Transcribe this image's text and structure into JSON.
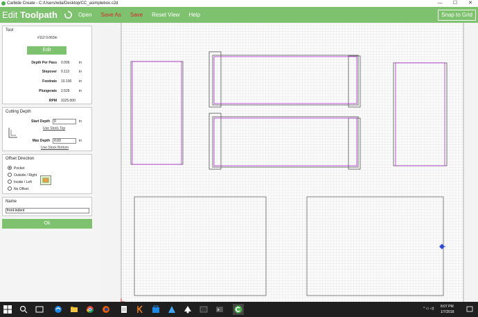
{
  "window": {
    "title": "Carbide Create - C:/Users/wila/Desktop/CC_asimplebox.c2d",
    "minimize": "—",
    "maximize": "☐",
    "close": "✕"
  },
  "toolbar": {
    "mode_prefix": "Edit",
    "mode_name": "Toolpath",
    "open": "Open",
    "save_as": "Save As",
    "save": "Save",
    "reset_view": "Reset View",
    "help": "Help",
    "snap_to_grid": "Snap to Grid"
  },
  "tool": {
    "section_title": "Tool",
    "tool_name": "#112 0.063in",
    "edit_label": "Edit",
    "fields": [
      {
        "label": "Depth Per Pass",
        "value": "0.006",
        "unit": "in"
      },
      {
        "label": "Stepover",
        "value": "0.113",
        "unit": "in"
      },
      {
        "label": "Feedrate",
        "value": "10.100",
        "unit": "in"
      },
      {
        "label": "Plungerate",
        "value": "2.525",
        "unit": "in"
      },
      {
        "label": "RPM",
        "value": "3125.000",
        "unit": ""
      }
    ]
  },
  "cutting_depth": {
    "section_title": "Cutting Depth",
    "start_label": "Start Depth",
    "start_value": "0",
    "start_unit": "in",
    "use_stock_top": "Use Stock Top",
    "max_label": "Max Depth",
    "max_value": "0.03",
    "max_unit": "in",
    "use_stock_bottom": "Use Stock Bottom"
  },
  "offset": {
    "section_title": "Offset Direction",
    "options": [
      "Pocket",
      "Outside / Right",
      "Inside / Left",
      "No Offset"
    ],
    "selected": "Pocket"
  },
  "name": {
    "section_title": "Name",
    "value": "front-indent"
  },
  "ok_label": "Ok",
  "colors": {
    "accent": "#7ec16e",
    "save_red": "#d42a2a",
    "toolpath_magenta": "#b030d0",
    "vector_outline": "#555555"
  },
  "taskbar": {
    "time": "8:07 PM",
    "date": "1/7/2018"
  }
}
